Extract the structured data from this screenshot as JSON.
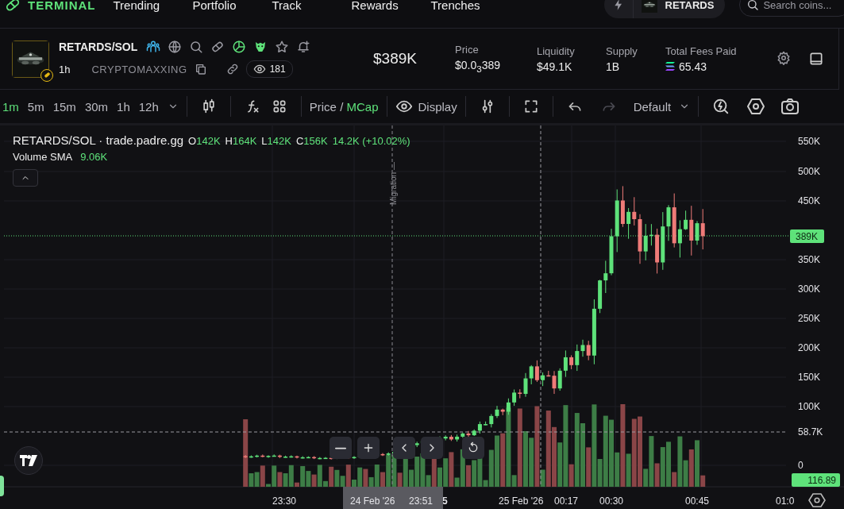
{
  "nav": {
    "brand": "TERMINAL",
    "links": [
      {
        "label": "Trending"
      },
      {
        "label": "Portfolio"
      },
      {
        "label": "Track"
      },
      {
        "label": "Rewards"
      },
      {
        "label": "Trenches"
      }
    ],
    "token_chip": "RETARDS",
    "search": {
      "placeholder": "Search coins..."
    }
  },
  "token": {
    "pair": "RETARDS/SOL",
    "interval": "1h",
    "tag": "CRYPTOMAXXING",
    "watchers": "181",
    "market_cap": "$389K",
    "stats": [
      {
        "label": "Price",
        "value": "$0.0$_{3}$389",
        "kind": "plain"
      },
      {
        "label": "Liquidity",
        "value": "$49.1K",
        "kind": "plain"
      },
      {
        "label": "Supply",
        "value": "1B",
        "kind": "plain"
      },
      {
        "label": "Total Fees Paid",
        "value": "65.43",
        "kind": "sol"
      }
    ]
  },
  "toolbar": {
    "intervals": [
      {
        "label": "1m",
        "selected": true
      },
      {
        "label": "5m",
        "selected": false
      },
      {
        "label": "15m",
        "selected": false
      },
      {
        "label": "30m",
        "selected": false
      },
      {
        "label": "1h",
        "selected": false
      },
      {
        "label": "12h",
        "selected": false
      }
    ],
    "price_mode": [
      {
        "label": "Price",
        "selected": false
      },
      {
        "label": "MCap",
        "selected": true
      }
    ],
    "mode_separator": "/",
    "display": "Display",
    "undo": {
      "disabled": false
    },
    "redo": {
      "disabled": true
    },
    "template": "Default"
  },
  "chart": {
    "legend": {
      "title": "RETARDS/SOL · trade.padre.gg",
      "ohlc": [
        {
          "key": "O",
          "value": "142K"
        },
        {
          "key": "H",
          "value": "164K"
        },
        {
          "key": "L",
          "value": "142K"
        },
        {
          "key": "C",
          "value": "156K"
        }
      ],
      "change": "14.2K (+10.02%)",
      "volume_label": "Volume SMA",
      "volume_value": "9.06K"
    },
    "marker_label": "Migration —",
    "y_axis": [
      "550K",
      "500K",
      "450K",
      "350K",
      "300K",
      "250K",
      "200K",
      "150K",
      "100K",
      "0"
    ],
    "crosshair_price": "58.7K",
    "last_price": "389K",
    "volume_last": "116.89",
    "time_axis": [
      "23:30",
      "5",
      "25 Feb '26",
      "00:17",
      "00:30",
      "00:45",
      "01:0"
    ],
    "crosshair_date": "24 Feb '26",
    "crosshair_time": "23:51"
  }
}
